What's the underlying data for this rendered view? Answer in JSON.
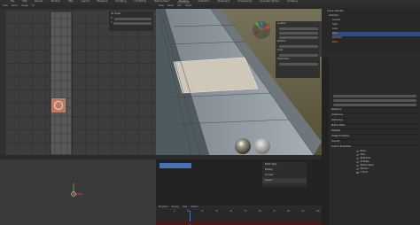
{
  "topbar": {
    "items": [
      "File",
      "Edit",
      "Render",
      "Window",
      "Help",
      "Layout",
      "Modeling",
      "Sculpting",
      "UV Editing",
      "Texture Paint",
      "Shading",
      "Animation",
      "Rendering",
      "Compositing",
      "Geometry Nodes",
      "Scripting"
    ]
  },
  "uv_editor": {
    "header": [
      "View",
      "Select",
      "Image",
      "UV"
    ],
    "panel_title": "UV Vertex",
    "panel_fields": [
      "X",
      "Y"
    ]
  },
  "viewport": {
    "header": [
      "View",
      "Select",
      "Add",
      "Object"
    ]
  },
  "n_panel": {
    "rows": [
      "Location",
      "Rotation",
      "Scale",
      "Dimensions"
    ]
  },
  "side_tabs": [
    "Item",
    "Tool",
    "View"
  ],
  "outliner": {
    "title": "Scene Collection",
    "items": [
      "Collection",
      "Camera",
      "Light",
      "Cube",
      "Road",
      "Road.001",
      "Plane"
    ]
  },
  "properties": {
    "sections": [
      "Relations",
      "Collections",
      "Instancing",
      "Motion Paths",
      "Visibility",
      "Viewport Display",
      "Line Art",
      "Custom Properties"
    ],
    "display_options": [
      "Name",
      "Axes",
      "Wireframe",
      "All Edges",
      "Texture Space",
      "Shadow",
      "In Front"
    ]
  },
  "node_area": {
    "menu": [
      "Editor Type",
      "Display",
      "Convert",
      "Layout"
    ]
  },
  "timeline": {
    "header": [
      "Playback",
      "Keying",
      "View",
      "Marker"
    ],
    "ticks": [
      "0",
      "10",
      "20",
      "30",
      "40",
      "50",
      "60",
      "70",
      "80",
      "90",
      "100"
    ]
  },
  "colors": {
    "accent": "#e87d0d",
    "select": "#4772b3",
    "bg": "#1d1d1d"
  }
}
